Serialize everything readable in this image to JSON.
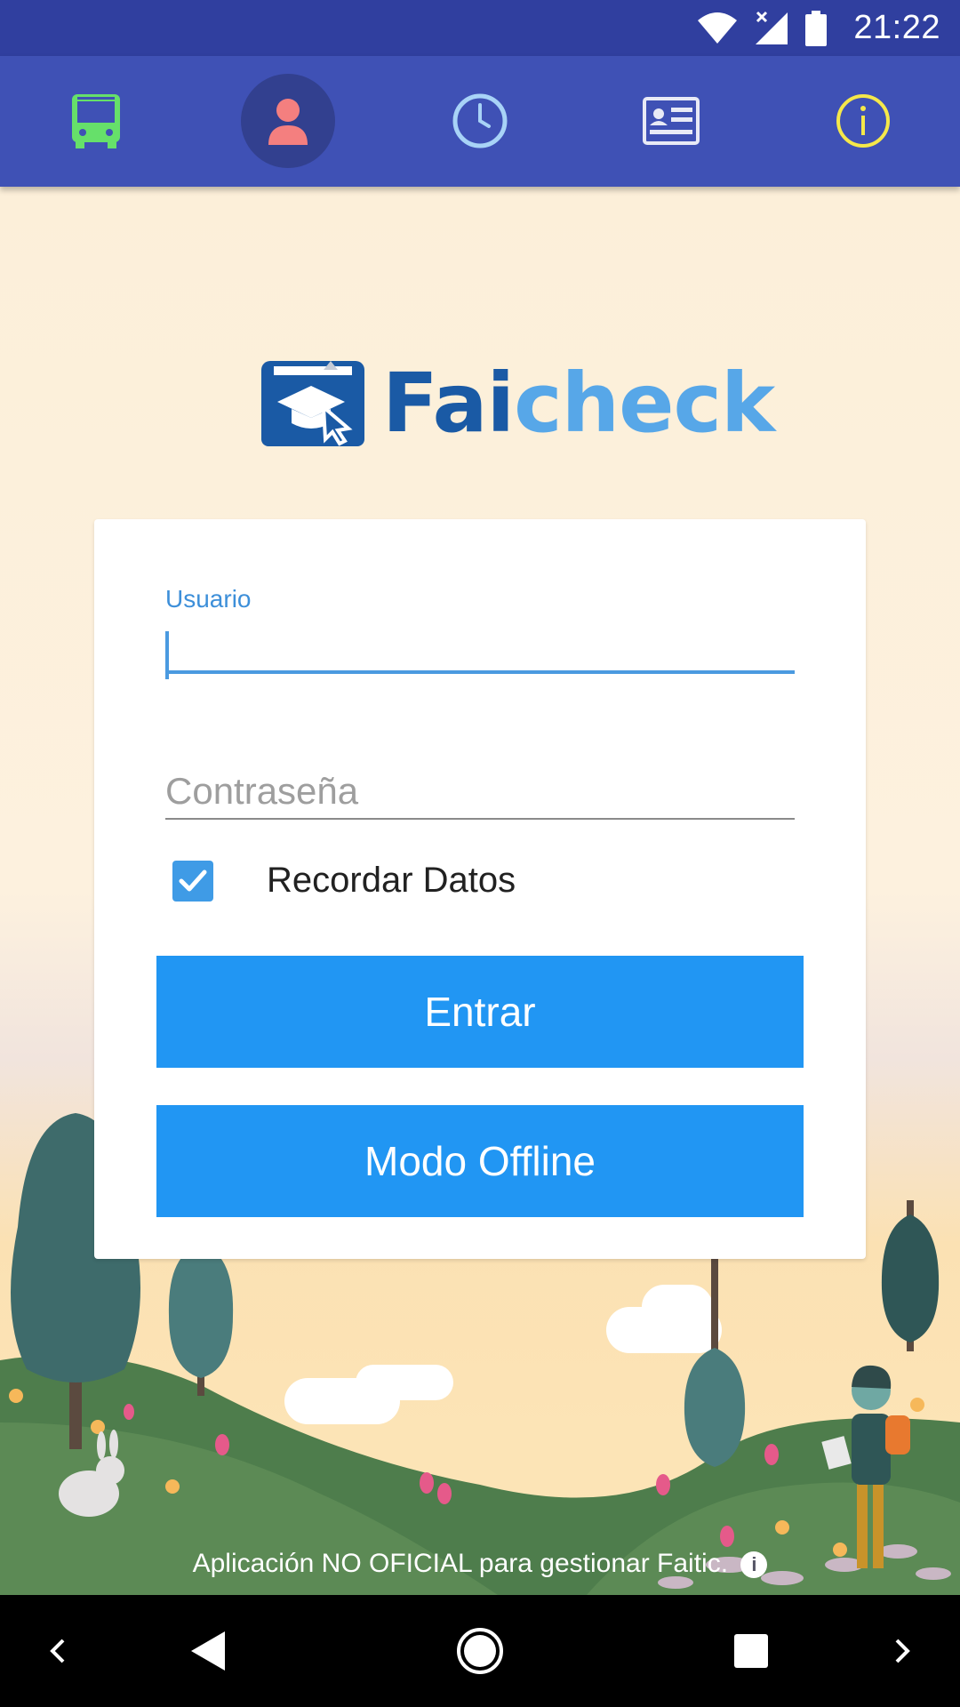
{
  "status_bar": {
    "time": "21:22",
    "icons": [
      "wifi-icon",
      "signal-icon",
      "battery-icon"
    ]
  },
  "nav": {
    "items": [
      {
        "name": "bus",
        "icon": "bus-icon",
        "color": "#66e06a"
      },
      {
        "name": "profile",
        "icon": "person-icon",
        "color": "#f47f7f",
        "active": true
      },
      {
        "name": "schedule",
        "icon": "clock-icon",
        "color": "#a8d3f7"
      },
      {
        "name": "card",
        "icon": "id-card-icon",
        "color": "#e8eaf6"
      },
      {
        "name": "info",
        "icon": "info-icon",
        "color": "#f5e84a"
      }
    ]
  },
  "logo": {
    "part1": "Fai",
    "part2": "check"
  },
  "login": {
    "username_label": "Usuario",
    "username_value": "",
    "password_placeholder": "Contraseña",
    "remember_label": "Recordar Datos",
    "remember_checked": true,
    "login_button": "Entrar",
    "offline_button": "Modo Offline"
  },
  "footer": {
    "note": "Aplicación NO OFICIAL para gestionar Faitic."
  },
  "colors": {
    "status_bar": "#303f9f",
    "top_bar": "#3f51b5",
    "accent": "#2196f3",
    "background": "#fcefd9"
  },
  "system_nav": [
    "chevron-left-icon",
    "back-icon",
    "home-icon",
    "recents-icon",
    "chevron-right-icon"
  ]
}
